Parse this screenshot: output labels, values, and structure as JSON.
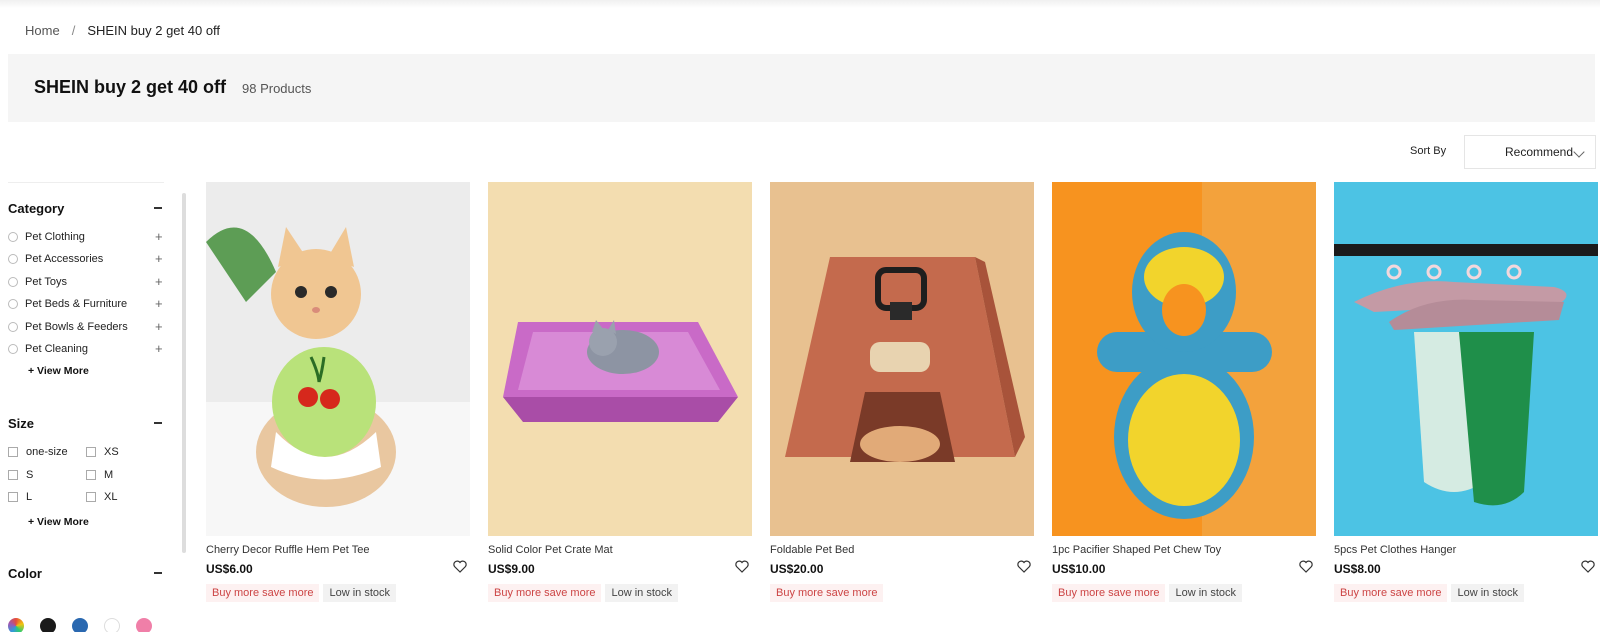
{
  "breadcrumb": {
    "home": "Home",
    "separator": "/",
    "current": "SHEIN buy 2 get 40 off"
  },
  "banner": {
    "title": "SHEIN buy 2 get 40 off",
    "count": "98 Products"
  },
  "sort": {
    "label": "Sort By",
    "selected": "Recommend"
  },
  "sidebar": {
    "category": {
      "title": "Category",
      "items": [
        {
          "label": "Pet Clothing"
        },
        {
          "label": "Pet Accessories"
        },
        {
          "label": "Pet Toys"
        },
        {
          "label": "Pet Beds & Furniture"
        },
        {
          "label": "Pet Bowls & Feeders"
        },
        {
          "label": "Pet Cleaning"
        }
      ],
      "view_more": "+ View More"
    },
    "size": {
      "title": "Size",
      "items": [
        {
          "label": "one-size"
        },
        {
          "label": "XS"
        },
        {
          "label": "S"
        },
        {
          "label": "M"
        },
        {
          "label": "L"
        },
        {
          "label": "XL"
        }
      ],
      "view_more": "+ View More"
    },
    "color": {
      "title": "Color",
      "swatches": [
        "multicolor",
        "#1a1a1a",
        "#2a68b0",
        "#ffffff",
        "#f07fa8"
      ]
    }
  },
  "products": [
    {
      "name": "Cherry Decor Ruffle Hem Pet Tee",
      "price": "US$6.00",
      "promo": "Buy more save more",
      "stock": "Low in stock",
      "bg": "#ececec"
    },
    {
      "name": "Solid Color Pet Crate Mat",
      "price": "US$9.00",
      "promo": "Buy more save more",
      "stock": "Low in stock",
      "bg": "#f3ddb0"
    },
    {
      "name": "Foldable Pet Bed",
      "price": "US$20.00",
      "promo": "Buy more save more",
      "stock": "",
      "bg": "#e8c190"
    },
    {
      "name": "1pc Pacifier Shaped Pet Chew Toy",
      "price": "US$10.00",
      "promo": "Buy more save more",
      "stock": "Low in stock",
      "bg": "#f7931f"
    },
    {
      "name": "5pcs Pet Clothes Hanger",
      "price": "US$8.00",
      "promo": "Buy more save more",
      "stock": "Low in stock",
      "bg": "#4cc3e4"
    }
  ]
}
